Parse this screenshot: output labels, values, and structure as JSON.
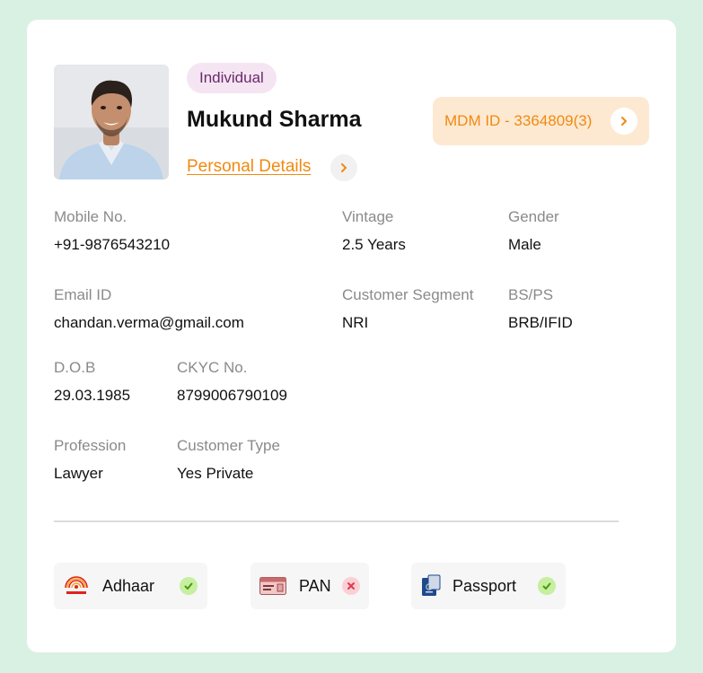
{
  "profile": {
    "tag": "Individual",
    "name": "Mukund Sharma",
    "details_link": "Personal Details",
    "mdm_id": "MDM ID - 3364809(3)"
  },
  "fields": {
    "mobile": {
      "label": "Mobile No.",
      "value": "+91-9876543210"
    },
    "vintage": {
      "label": "Vintage",
      "value": "2.5 Years"
    },
    "gender": {
      "label": "Gender",
      "value": "Male"
    },
    "email": {
      "label": "Email ID",
      "value": "chandan.verma@gmail.com"
    },
    "segment": {
      "label": "Customer Segment",
      "value": "NRI"
    },
    "bsps": {
      "label": "BS/PS",
      "value": "BRB/IFID"
    },
    "dob": {
      "label": "D.O.B",
      "value": "29.03.1985"
    },
    "ckyc": {
      "label": "CKYC No.",
      "value": "8799006790109"
    },
    "profession": {
      "label": "Profession",
      "value": "Lawyer"
    },
    "customer_type": {
      "label": "Customer Type",
      "value": "Yes Private"
    }
  },
  "documents": [
    {
      "label": "Adhaar",
      "status": "verified",
      "icon": "aadhaar-icon"
    },
    {
      "label": "PAN",
      "status": "rejected",
      "icon": "pan-card-icon"
    },
    {
      "label": "Passport",
      "status": "verified",
      "icon": "passport-icon"
    }
  ],
  "colors": {
    "accent": "#f08a10",
    "background": "#d9f1e3",
    "tag_bg": "#f5e5f3",
    "mdm_bg": "#fde9d2",
    "verified": "#6cbf2a",
    "rejected": "#e23a4d"
  }
}
